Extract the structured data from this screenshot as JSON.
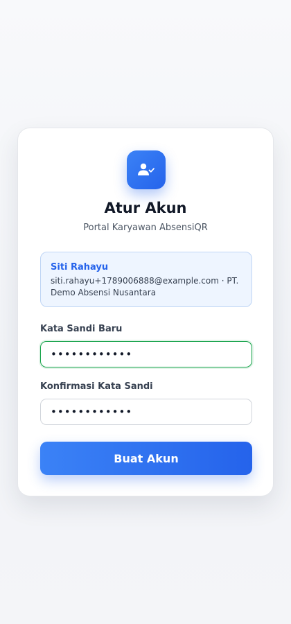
{
  "header": {
    "icon": "user-check-icon",
    "title": "Atur Akun",
    "subtitle": "Portal Karyawan AbsensiQR"
  },
  "user": {
    "name": "Siti Rahayu",
    "meta": "siti.rahayu+1789006888@example.com · PT. Demo Absensi Nusantara"
  },
  "form": {
    "new_password_label": "Kata Sandi Baru",
    "new_password_value": "••••••••••••",
    "confirm_password_label": "Konfirmasi Kata Sandi",
    "confirm_password_value": "••••••••••••",
    "submit_label": "Buat Akun"
  },
  "colors": {
    "accent": "#2563eb",
    "focus_border": "#16a34a",
    "info_bg": "#eef5ff"
  }
}
